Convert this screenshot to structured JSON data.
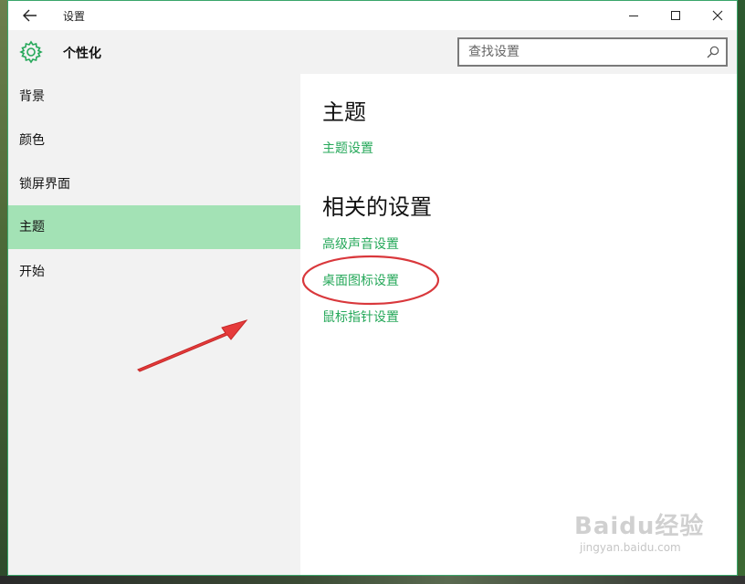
{
  "window": {
    "title": "设置",
    "controls": [
      "minimize",
      "maximize",
      "close"
    ]
  },
  "header": {
    "section_title": "个性化",
    "search_placeholder": "查找设置",
    "icon": "gear-icon"
  },
  "sidebar": {
    "items": [
      {
        "label": "背景",
        "active": false
      },
      {
        "label": "颜色",
        "active": false
      },
      {
        "label": "锁屏界面",
        "active": false
      },
      {
        "label": "主题",
        "active": true
      },
      {
        "label": "开始",
        "active": false
      }
    ]
  },
  "content": {
    "heading": "主题",
    "theme_settings_link": "主题设置",
    "related_heading": "相关的设置",
    "related_links": [
      "高级声音设置",
      "桌面图标设置",
      "鼠标指针设置"
    ]
  },
  "colors": {
    "accent": "#26a85a",
    "active_item": "#a3e2b5",
    "annotation": "#d9383c"
  },
  "watermark": {
    "logo": "Baidu经验",
    "url": "jingyan.baidu.com"
  }
}
